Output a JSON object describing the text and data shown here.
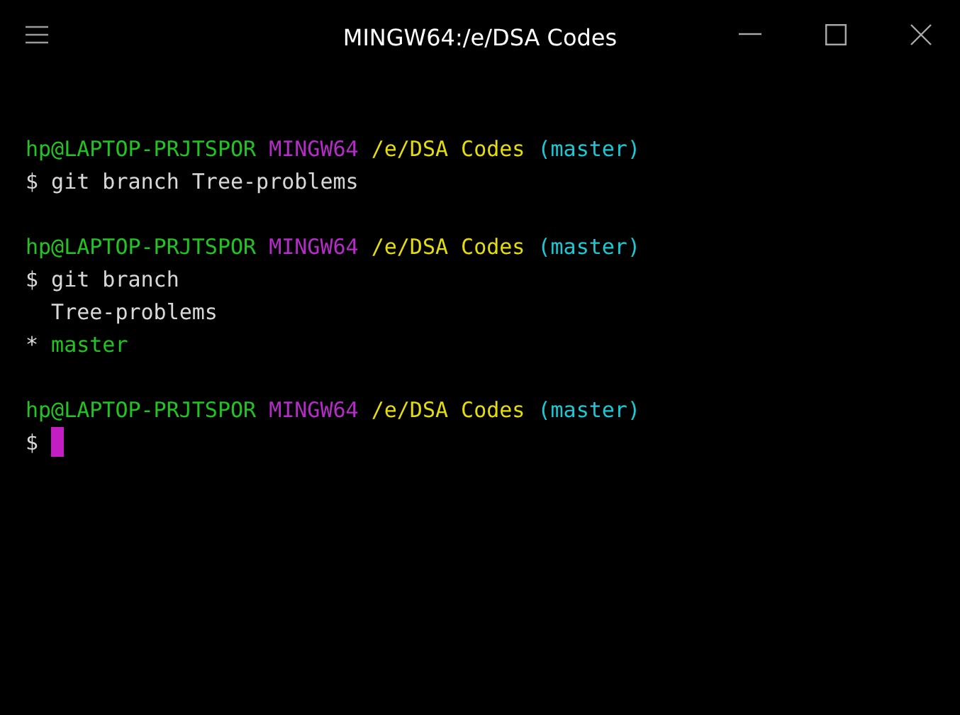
{
  "window": {
    "title": "MINGW64:/e/DSA Codes"
  },
  "blocks": [
    {
      "prompt": {
        "user": "hp@LAPTOP-PRJTSPOR",
        "shell": "MINGW64",
        "path": "/e/DSA Codes",
        "branch": "(master)"
      },
      "command": "$ git branch Tree-problems"
    },
    {
      "prompt": {
        "user": "hp@LAPTOP-PRJTSPOR",
        "shell": "MINGW64",
        "path": "/e/DSA Codes",
        "branch": "(master)"
      },
      "command": "$ git branch",
      "output": [
        {
          "text": "Tree-problems",
          "current": false
        },
        {
          "marker": "*",
          "text": "master",
          "current": true
        }
      ]
    },
    {
      "prompt": {
        "user": "hp@LAPTOP-PRJTSPOR",
        "shell": "MINGW64",
        "path": "/e/DSA Codes",
        "branch": "(master)"
      },
      "command": "$",
      "cursor": true
    }
  ]
}
